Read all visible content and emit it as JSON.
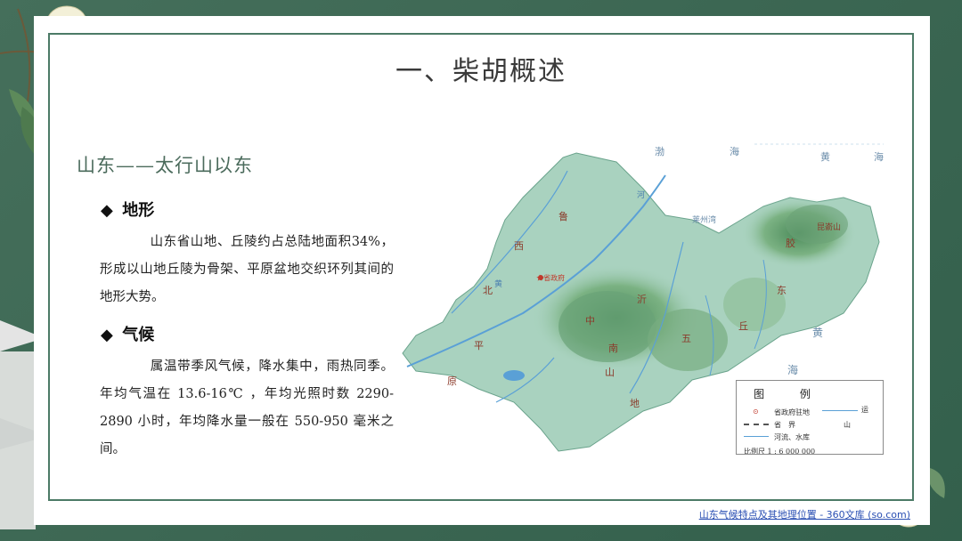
{
  "slide": {
    "title": "一、柴胡概述",
    "subtitle": "山东——太行山以东"
  },
  "sections": [
    {
      "heading": "地形",
      "bullet": "◆",
      "text": "山东省山地、丘陵约占总陆地面积34%，形成以山地丘陵为骨架、平原盆地交织环列其间的地形大势。"
    },
    {
      "heading": "气候",
      "bullet": "◆",
      "text": "属温带季风气候，降水集中，雨热同季。年均气温在 13.6-16℃ ，年均光照时数 2290-2890 小时，年均降水量一般在 550-950 毫米之间。"
    }
  ],
  "map": {
    "labels": {
      "bohai": "渤",
      "bohai2": "海",
      "huang_top": "黄",
      "huang_top2": "海",
      "laizhou": "莱州湾",
      "lu": "鲁",
      "xi": "西",
      "bei": "北",
      "ping": "平",
      "yuan": "原",
      "capital": "★省政府",
      "jiaodong1": "胶",
      "jiaodong2": "东",
      "yi": "沂",
      "wu": "五",
      "qiu": "丘",
      "huang_sea": "黄",
      "hai_sea": "海",
      "he": "河",
      "he2": "黄",
      "zhong": "中",
      "nan": "南",
      "shan": "山",
      "di": "地",
      "kunyu": "昆嵛山"
    },
    "legend": {
      "title": "图 例",
      "capital": "省政府驻地",
      "canal": "运",
      "border": "省　界",
      "mountain": "山",
      "river": "河流、水库",
      "scale": "比例尺 1 : 6 000 000"
    },
    "colors": {
      "land": "#a9d2bf",
      "mountain": "#5f9a6b",
      "sea": "#ffffff",
      "river": "#5aa0d6",
      "label": "#8b3a2a"
    }
  },
  "caption": "山东气候特点及其地理位置 - 360文库 (so.com)"
}
